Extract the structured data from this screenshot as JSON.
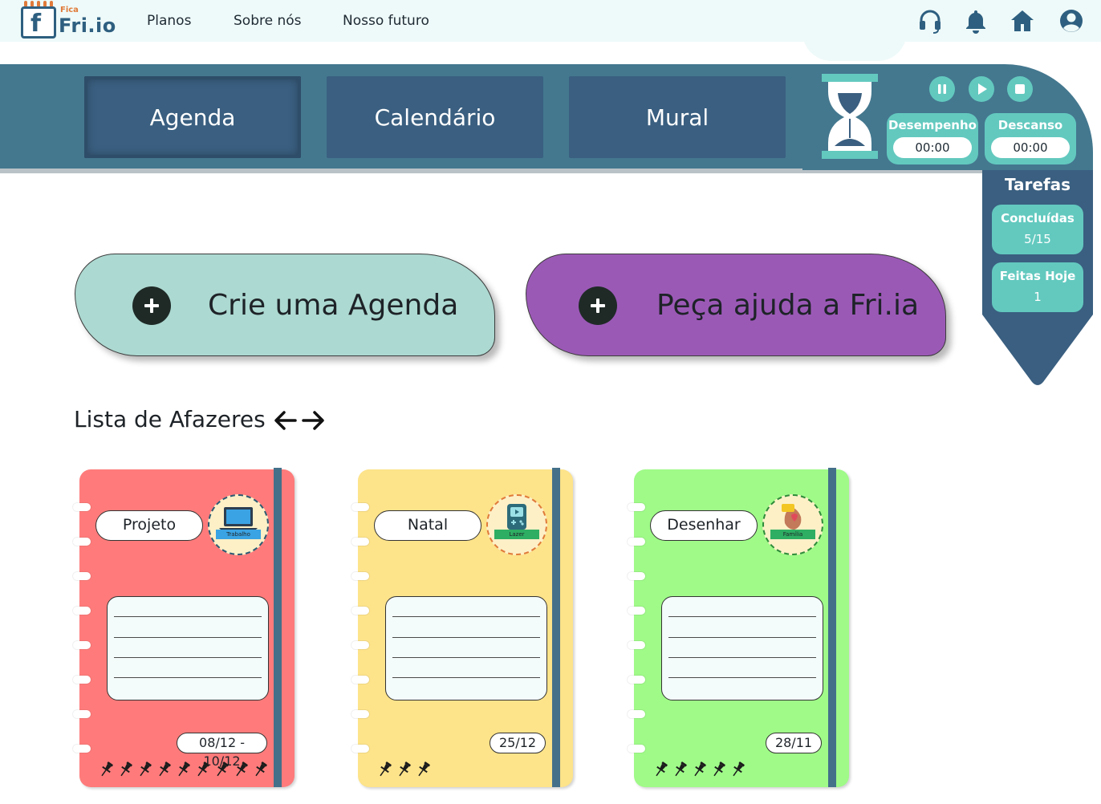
{
  "brand": {
    "small": "Fica",
    "name": "Fri.io",
    "letter": "f"
  },
  "nav": {
    "links": [
      "Planos",
      "Sobre nós",
      "Nosso futuro"
    ]
  },
  "tabs": [
    "Agenda",
    "Calendário",
    "Mural"
  ],
  "timer": {
    "desempenho_label": "Desempenho",
    "desempenho_value": "00:00",
    "descanso_label": "Descanso",
    "descanso_value": "00:00"
  },
  "tarefas": {
    "title": "Tarefas",
    "concluidas_label": "Concluídas",
    "concluidas_value": "5/15",
    "hoje_label": "Feitas Hoje",
    "hoje_value": "1"
  },
  "actions": {
    "create_label": "Crie uma Agenda",
    "ai_label": "Peça ajuda a Fri.ia"
  },
  "list": {
    "title": "Lista de Afazeres"
  },
  "notebooks": [
    {
      "title": "Projeto",
      "badge": "Trabalho",
      "date": "08/12 - 10/12",
      "pins": 9,
      "color": "#ff7b7b"
    },
    {
      "title": "Natal",
      "badge": "Lazer",
      "date": "25/12",
      "pins": 3,
      "color": "#fde38a"
    },
    {
      "title": "Desenhar",
      "badge": "Família",
      "date": "28/11",
      "pins": 5,
      "color": "#9ffa88"
    }
  ],
  "colors": {
    "teal": "#63c9bf",
    "bar": "#44788f",
    "tab": "#3a5f80",
    "create": "#acd9d1",
    "ai": "#9b59b6"
  }
}
